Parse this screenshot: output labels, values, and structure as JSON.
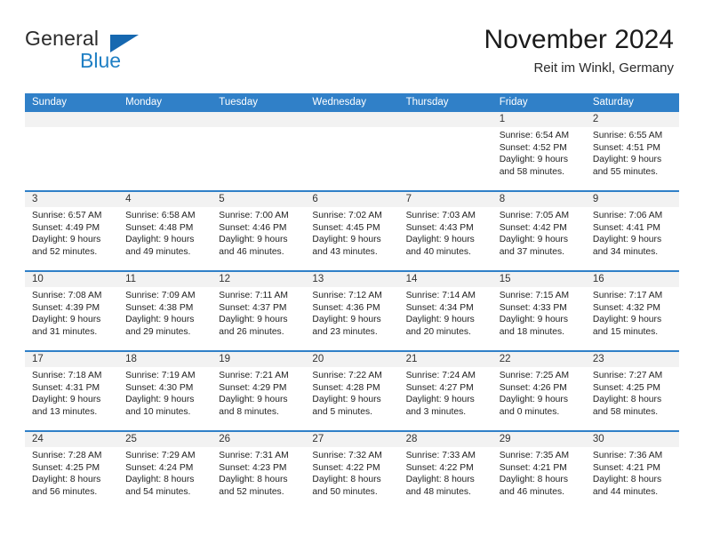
{
  "brand": {
    "name_part1": "General",
    "name_part2": "Blue",
    "triangle_color": "#1668b0",
    "blue_color": "#1f7fc4"
  },
  "header": {
    "title": "November 2024",
    "subtitle": "Reit im Winkl, Germany"
  },
  "theme": {
    "header_bar_color": "#3080c8",
    "daynum_strip_color": "#f2f2f2",
    "cell_background": "#ffffff"
  },
  "weekday_headers": [
    "Sunday",
    "Monday",
    "Tuesday",
    "Wednesday",
    "Thursday",
    "Friday",
    "Saturday"
  ],
  "weeks": [
    [
      {
        "day": "",
        "lines": []
      },
      {
        "day": "",
        "lines": []
      },
      {
        "day": "",
        "lines": []
      },
      {
        "day": "",
        "lines": []
      },
      {
        "day": "",
        "lines": []
      },
      {
        "day": "1",
        "lines": [
          "Sunrise: 6:54 AM",
          "Sunset: 4:52 PM",
          "Daylight: 9 hours",
          "and 58 minutes."
        ]
      },
      {
        "day": "2",
        "lines": [
          "Sunrise: 6:55 AM",
          "Sunset: 4:51 PM",
          "Daylight: 9 hours",
          "and 55 minutes."
        ]
      }
    ],
    [
      {
        "day": "3",
        "lines": [
          "Sunrise: 6:57 AM",
          "Sunset: 4:49 PM",
          "Daylight: 9 hours",
          "and 52 minutes."
        ]
      },
      {
        "day": "4",
        "lines": [
          "Sunrise: 6:58 AM",
          "Sunset: 4:48 PM",
          "Daylight: 9 hours",
          "and 49 minutes."
        ]
      },
      {
        "day": "5",
        "lines": [
          "Sunrise: 7:00 AM",
          "Sunset: 4:46 PM",
          "Daylight: 9 hours",
          "and 46 minutes."
        ]
      },
      {
        "day": "6",
        "lines": [
          "Sunrise: 7:02 AM",
          "Sunset: 4:45 PM",
          "Daylight: 9 hours",
          "and 43 minutes."
        ]
      },
      {
        "day": "7",
        "lines": [
          "Sunrise: 7:03 AM",
          "Sunset: 4:43 PM",
          "Daylight: 9 hours",
          "and 40 minutes."
        ]
      },
      {
        "day": "8",
        "lines": [
          "Sunrise: 7:05 AM",
          "Sunset: 4:42 PM",
          "Daylight: 9 hours",
          "and 37 minutes."
        ]
      },
      {
        "day": "9",
        "lines": [
          "Sunrise: 7:06 AM",
          "Sunset: 4:41 PM",
          "Daylight: 9 hours",
          "and 34 minutes."
        ]
      }
    ],
    [
      {
        "day": "10",
        "lines": [
          "Sunrise: 7:08 AM",
          "Sunset: 4:39 PM",
          "Daylight: 9 hours",
          "and 31 minutes."
        ]
      },
      {
        "day": "11",
        "lines": [
          "Sunrise: 7:09 AM",
          "Sunset: 4:38 PM",
          "Daylight: 9 hours",
          "and 29 minutes."
        ]
      },
      {
        "day": "12",
        "lines": [
          "Sunrise: 7:11 AM",
          "Sunset: 4:37 PM",
          "Daylight: 9 hours",
          "and 26 minutes."
        ]
      },
      {
        "day": "13",
        "lines": [
          "Sunrise: 7:12 AM",
          "Sunset: 4:36 PM",
          "Daylight: 9 hours",
          "and 23 minutes."
        ]
      },
      {
        "day": "14",
        "lines": [
          "Sunrise: 7:14 AM",
          "Sunset: 4:34 PM",
          "Daylight: 9 hours",
          "and 20 minutes."
        ]
      },
      {
        "day": "15",
        "lines": [
          "Sunrise: 7:15 AM",
          "Sunset: 4:33 PM",
          "Daylight: 9 hours",
          "and 18 minutes."
        ]
      },
      {
        "day": "16",
        "lines": [
          "Sunrise: 7:17 AM",
          "Sunset: 4:32 PM",
          "Daylight: 9 hours",
          "and 15 minutes."
        ]
      }
    ],
    [
      {
        "day": "17",
        "lines": [
          "Sunrise: 7:18 AM",
          "Sunset: 4:31 PM",
          "Daylight: 9 hours",
          "and 13 minutes."
        ]
      },
      {
        "day": "18",
        "lines": [
          "Sunrise: 7:19 AM",
          "Sunset: 4:30 PM",
          "Daylight: 9 hours",
          "and 10 minutes."
        ]
      },
      {
        "day": "19",
        "lines": [
          "Sunrise: 7:21 AM",
          "Sunset: 4:29 PM",
          "Daylight: 9 hours",
          "and 8 minutes."
        ]
      },
      {
        "day": "20",
        "lines": [
          "Sunrise: 7:22 AM",
          "Sunset: 4:28 PM",
          "Daylight: 9 hours",
          "and 5 minutes."
        ]
      },
      {
        "day": "21",
        "lines": [
          "Sunrise: 7:24 AM",
          "Sunset: 4:27 PM",
          "Daylight: 9 hours",
          "and 3 minutes."
        ]
      },
      {
        "day": "22",
        "lines": [
          "Sunrise: 7:25 AM",
          "Sunset: 4:26 PM",
          "Daylight: 9 hours",
          "and 0 minutes."
        ]
      },
      {
        "day": "23",
        "lines": [
          "Sunrise: 7:27 AM",
          "Sunset: 4:25 PM",
          "Daylight: 8 hours",
          "and 58 minutes."
        ]
      }
    ],
    [
      {
        "day": "24",
        "lines": [
          "Sunrise: 7:28 AM",
          "Sunset: 4:25 PM",
          "Daylight: 8 hours",
          "and 56 minutes."
        ]
      },
      {
        "day": "25",
        "lines": [
          "Sunrise: 7:29 AM",
          "Sunset: 4:24 PM",
          "Daylight: 8 hours",
          "and 54 minutes."
        ]
      },
      {
        "day": "26",
        "lines": [
          "Sunrise: 7:31 AM",
          "Sunset: 4:23 PM",
          "Daylight: 8 hours",
          "and 52 minutes."
        ]
      },
      {
        "day": "27",
        "lines": [
          "Sunrise: 7:32 AM",
          "Sunset: 4:22 PM",
          "Daylight: 8 hours",
          "and 50 minutes."
        ]
      },
      {
        "day": "28",
        "lines": [
          "Sunrise: 7:33 AM",
          "Sunset: 4:22 PM",
          "Daylight: 8 hours",
          "and 48 minutes."
        ]
      },
      {
        "day": "29",
        "lines": [
          "Sunrise: 7:35 AM",
          "Sunset: 4:21 PM",
          "Daylight: 8 hours",
          "and 46 minutes."
        ]
      },
      {
        "day": "30",
        "lines": [
          "Sunrise: 7:36 AM",
          "Sunset: 4:21 PM",
          "Daylight: 8 hours",
          "and 44 minutes."
        ]
      }
    ]
  ]
}
